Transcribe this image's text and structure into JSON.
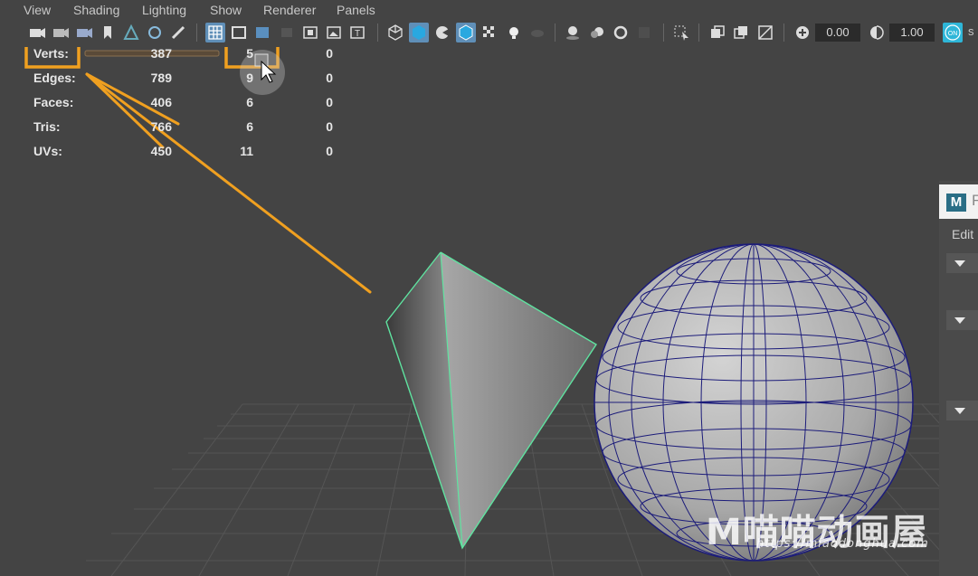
{
  "menu": [
    "View",
    "Shading",
    "Lighting",
    "Show",
    "Renderer",
    "Panels"
  ],
  "toolbar": {
    "exposure_value": "0.00",
    "gamma_value": "1.00"
  },
  "hud": {
    "rows": [
      {
        "label": "Verts:",
        "total": "387",
        "selected": "5",
        "third": "0"
      },
      {
        "label": "Edges:",
        "total": "789",
        "selected": "9",
        "third": "0"
      },
      {
        "label": "Faces:",
        "total": "406",
        "selected": "6",
        "third": "0"
      },
      {
        "label": "Tris:",
        "total": "766",
        "selected": "6",
        "third": "0"
      },
      {
        "label": "UVs:",
        "total": "450",
        "selected": "11",
        "third": "0"
      }
    ]
  },
  "side_panel": {
    "logo": "M",
    "title_truncated": "F",
    "edit_label": "Edit"
  },
  "watermark": {
    "brand": "M喵喵动画屋",
    "url": "https://miaodonghua.com"
  },
  "colors": {
    "viewport_bg": "#444444",
    "highlight": "#f0a020",
    "wire_selected": "#5fe3a0",
    "sphere_wire": "#1c1c7a"
  }
}
